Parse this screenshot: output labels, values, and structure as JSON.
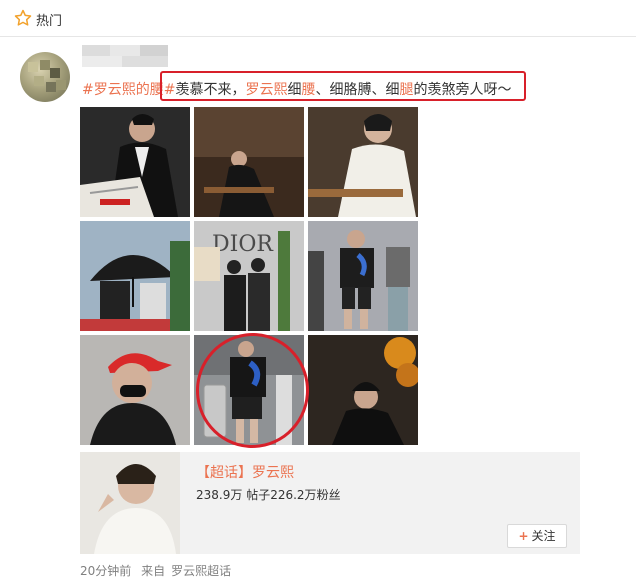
{
  "header": {
    "title": "热门",
    "icon": "star-icon"
  },
  "post": {
    "username": "",
    "content": {
      "topic": "#罗云熙的腰#",
      "before": "羡慕不来，",
      "name": "罗云熙",
      "s1": "细",
      "w1": "腰",
      "s2": "、细胳膊、细",
      "w2": "腿",
      "s3": "的",
      "end": "羡煞旁人呀～"
    },
    "images": [
      "photo-1",
      "photo-2",
      "photo-3",
      "photo-4",
      "photo-5",
      "photo-6",
      "photo-7",
      "photo-8",
      "photo-9"
    ],
    "annotation_color": "#d8202a",
    "card": {
      "name": "【超话】罗云熙",
      "reads": "238.9万",
      "posts_label": "帖子",
      "posts": "226.2万",
      "fans_label": "粉丝",
      "follow_label": "关注"
    },
    "footer": {
      "time": "20分钟前",
      "source_prefix": "来自",
      "source": "罗云熙超话"
    }
  },
  "colors": {
    "accent": "#eb7350",
    "annotation": "#d8202a",
    "card_bg": "#f2f2f2"
  }
}
